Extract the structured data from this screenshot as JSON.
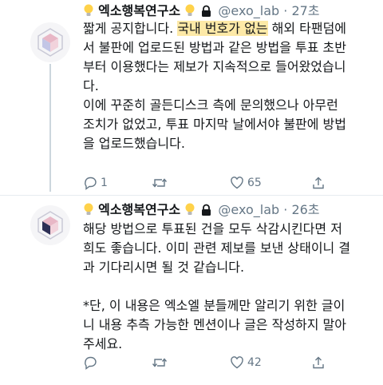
{
  "tweets": [
    {
      "name": "엑소행복연구소",
      "handle": "@exo_lab",
      "time_sep": "·",
      "time": "27초",
      "lines": [
        {
          "before": "짧게 공지합니다. ",
          "highlight": "국내 번호가 없는",
          "after": " 해외 타팬덤에"
        },
        {
          "text": "서 불판에 업로드된 방법과 같은 방법을 투표 초반"
        },
        {
          "text": "부터 이용했다는 제보가 지속적으로 들어왔었습니"
        },
        {
          "text": "다."
        },
        {
          "text": "이에 꾸준히 골든디스크 측에 문의했으나 아무런"
        },
        {
          "text": "조치가 없었고, 투표 마지막 날에서야 불판에 방법"
        },
        {
          "text": "을 업로드했습니다."
        }
      ],
      "reply_count": "1",
      "retweet_count": "",
      "like_count": "65",
      "icons": [
        "bulb-icon",
        "lock-icon",
        "reply-icon",
        "retweet-icon",
        "heart-icon",
        "share-icon"
      ]
    },
    {
      "name": "엑소행복연구소",
      "handle": "@exo_lab",
      "time_sep": "·",
      "time": "26초",
      "lines": [
        "해당 방법으로 투표된 건을 모두 삭감시킨다면 저",
        "희도 좋습니다. 이미 관련 제보를 보낸 상태이니 결",
        "과 기다리시면 될 것 같습니다.",
        "",
        "*단, 이 내용은 엑소엘 분들께만 알리기 위한 글이",
        "니 내용 추측 가능한 멘션이나 글은 작성하지 말아",
        "주세요."
      ],
      "reply_count": "",
      "retweet_count": "",
      "like_count": "42"
    }
  ],
  "colors": {
    "text": "#14171a",
    "secondary": "#657786",
    "highlight": "#fde9a7",
    "bulb": "#ffd24a",
    "divider": "#e6ecf0"
  }
}
